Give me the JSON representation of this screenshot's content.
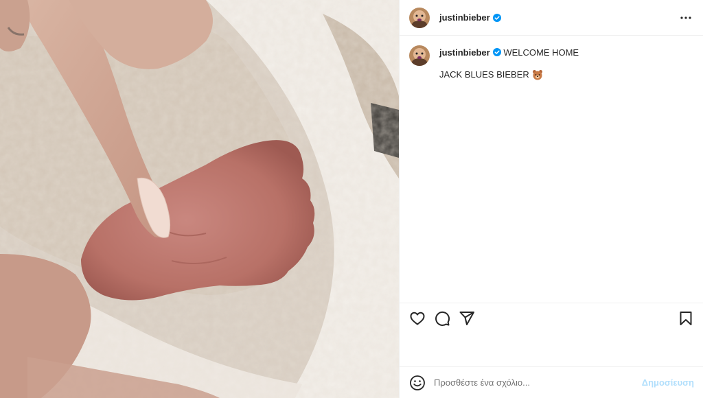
{
  "post": {
    "username": "justinbieber",
    "verified": true,
    "caption_line1": "WELCOME HOME",
    "caption_line2": "JACK BLUES BIEBER",
    "caption_emoji": "bear-face-emoji"
  },
  "icons": {
    "more": "more-horizontal-icon",
    "like": "heart-icon",
    "comment": "comment-bubble-icon",
    "share": "paper-plane-icon",
    "save": "bookmark-icon",
    "emoji": "smiley-icon",
    "verified": "verified-badge-icon"
  },
  "comment_box": {
    "placeholder": "Προσθέστε ένα σχόλιο...",
    "post_label": "Δημοσίευση"
  },
  "colors": {
    "verified_badge": "#0095f6",
    "post_button_disabled": "#b2dffc",
    "text": "#262626",
    "divider": "#efefef"
  }
}
